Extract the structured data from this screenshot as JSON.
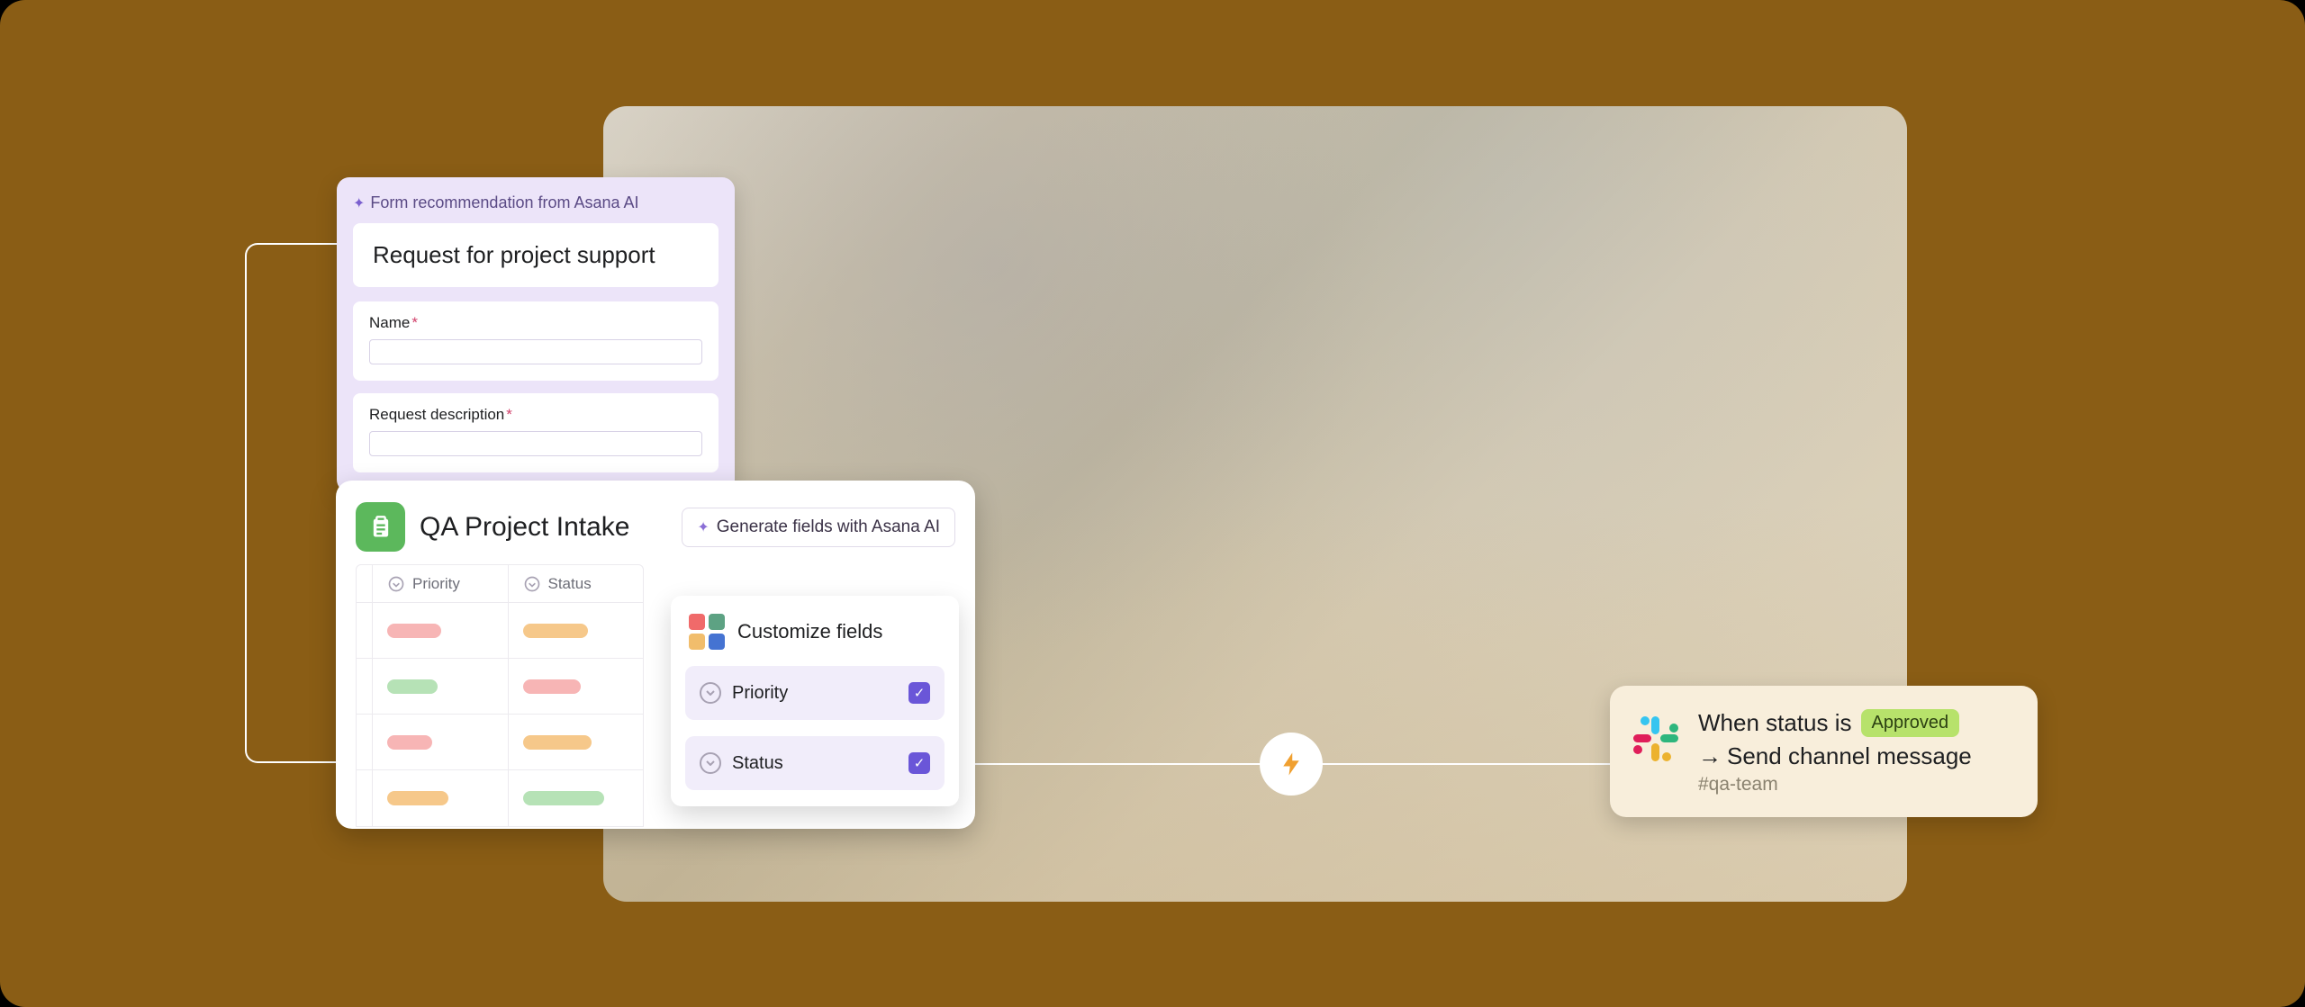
{
  "form": {
    "ai_label": "Form recommendation from Asana AI",
    "title": "Request for project support",
    "fields": [
      {
        "label": "Name",
        "required": true
      },
      {
        "label": "Request description",
        "required": true
      }
    ]
  },
  "qa": {
    "title": "QA Project Intake",
    "generate_label": "Generate fields with Asana AI",
    "columns": [
      "Priority",
      "Status"
    ],
    "rows": [
      {
        "priority_color": "#f7b5b5",
        "priority_w": 60,
        "status_color": "#f6c88a",
        "status_w": 72
      },
      {
        "priority_color": "#b6e2b6",
        "priority_w": 56,
        "status_color": "#f7b5b5",
        "status_w": 64
      },
      {
        "priority_color": "#f7b5b5",
        "priority_w": 50,
        "status_color": "#f6c88a",
        "status_w": 76
      },
      {
        "priority_color": "#f6c88a",
        "priority_w": 68,
        "status_color": "#b6e2b6",
        "status_w": 90
      }
    ]
  },
  "customize": {
    "title": "Customize fields",
    "fields": [
      "Priority",
      "Status"
    ]
  },
  "automation": {
    "line1_prefix": "When status is",
    "badge": "Approved",
    "arrow": "→",
    "line2": "Send channel message",
    "channel": "#qa-team"
  },
  "icons": {
    "grid_colors": [
      "#f06a6a",
      "#5da283",
      "#f1bd6c",
      "#4573d2"
    ]
  }
}
